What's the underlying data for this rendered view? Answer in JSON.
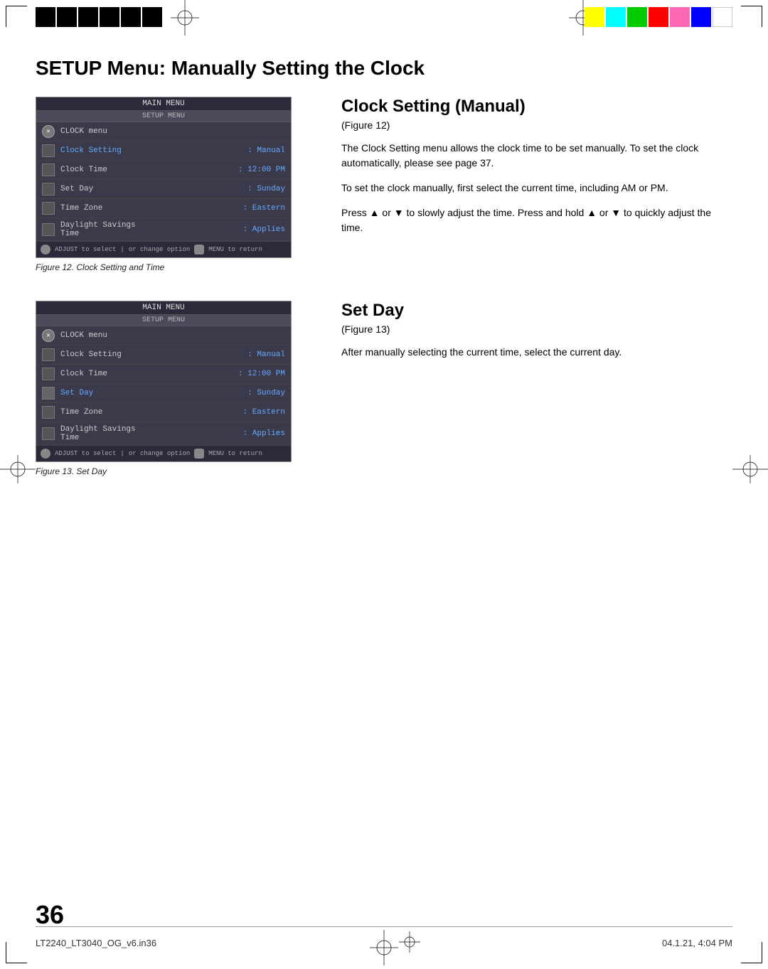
{
  "page": {
    "title": "SETUP Menu: Manually Setting the Clock",
    "number": "36",
    "footer_left": "LT2240_LT3040_OG_v6.in36",
    "footer_right": "04.1.21, 4:04 PM"
  },
  "figure12": {
    "heading": "Clock Setting (Manual)",
    "figure_ref": "(Figure 12)",
    "caption": "Figure 12.  Clock Setting and Time",
    "text1": "The Clock Setting menu allows the clock time to be set manually.  To set the clock automatically, please see page 37.",
    "text2": "To set the clock manually, first select the current time, including AM or PM.",
    "text3": "Press ▲ or ▼ to slowly adjust the time.  Press and hold ▲ or ▼ to quickly adjust the time.",
    "menu": {
      "header": "MAIN MENU",
      "subheader": "SETUP MENU",
      "clock_menu_label": "CLOCK menu",
      "items": [
        {
          "label": "Clock Setting",
          "value": ": Manual",
          "highlighted": true
        },
        {
          "label": "Clock Time",
          "value": ": 12:00 PM",
          "highlighted": false
        },
        {
          "label": "Set Day",
          "value": ": Sunday",
          "highlighted": false
        },
        {
          "label": "Time Zone",
          "value": ": Eastern",
          "highlighted": false
        },
        {
          "label": "Daylight Savings Time",
          "value": ": Applies",
          "highlighted": false
        }
      ],
      "footer_text1": "ADJUST to select",
      "footer_text2": "or change option",
      "footer_text3": "MENU to return"
    }
  },
  "figure13": {
    "heading": "Set Day",
    "figure_ref": "(Figure 13)",
    "caption": "Figure 13.  Set Day",
    "text1": "After manually selecting the current time, select the current day.",
    "menu": {
      "header": "MAIN MENU",
      "subheader": "SETUP MENU",
      "clock_menu_label": "CLOCK menu",
      "items": [
        {
          "label": "Clock Setting",
          "value": ": Manual",
          "highlighted": false
        },
        {
          "label": "Clock Time",
          "value": ": 12:00 PM",
          "highlighted": false
        },
        {
          "label": "Set Day",
          "value": ": Sunday",
          "highlighted": true
        },
        {
          "label": "Time Zone",
          "value": ": Eastern",
          "highlighted": false
        },
        {
          "label": "Daylight Savings Time",
          "value": ": Applies",
          "highlighted": false
        }
      ],
      "footer_text1": "ADJUST to select",
      "footer_text2": "or change option",
      "footer_text3": "MENU to return"
    }
  },
  "colors": {
    "bar1": "#000000",
    "bar2": "#222222",
    "bar3": "#444444",
    "bar4": "#666666",
    "bar5": "#888888",
    "bar6": "#aaaaaa",
    "color1": "#ffff00",
    "color2": "#00ffff",
    "color3": "#00ff00",
    "color4": "#ff0000",
    "color5": "#ff69b4",
    "color6": "#0000ff",
    "color7": "#ffffff"
  }
}
